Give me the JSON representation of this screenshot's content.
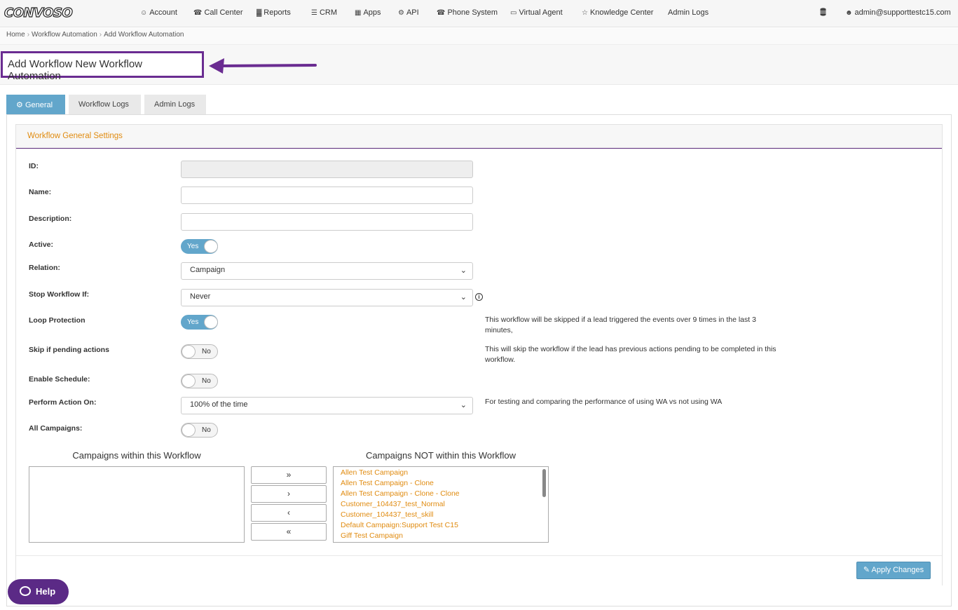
{
  "navbar": {
    "logo": "CONVOSO",
    "items": [
      {
        "label": "Account",
        "icon": "user-icon",
        "glyph": "☺"
      },
      {
        "label": "Call Center",
        "icon": "phone-icon",
        "glyph": "☎"
      },
      {
        "label": "Reports",
        "icon": "bar-chart-icon",
        "glyph": "▓"
      },
      {
        "label": "CRM",
        "icon": "list-icon",
        "glyph": "☰"
      },
      {
        "label": "Apps",
        "icon": "grid-icon",
        "glyph": "▦"
      },
      {
        "label": "API",
        "icon": "gear-icon",
        "glyph": "⚙"
      },
      {
        "label": "Phone System",
        "icon": "phone-icon",
        "glyph": "☎"
      },
      {
        "label": "Virtual Agent",
        "icon": "monitor-icon",
        "glyph": "▭"
      },
      {
        "label": "Knowledge Center",
        "icon": "lightbulb-icon",
        "glyph": "☆"
      },
      {
        "label": "Admin Logs",
        "icon": "",
        "glyph": ""
      }
    ],
    "database_icon": "database-icon",
    "user_email": "admin@supporttestc15.com"
  },
  "breadcrumb": [
    "Home",
    "Workflow Automation",
    "Add Workflow Automation"
  ],
  "page_title": "Add Workflow New Workflow Automation",
  "tabs": [
    {
      "label": "General",
      "active": true
    },
    {
      "label": "Workflow Logs",
      "active": false
    },
    {
      "label": "Admin Logs",
      "active": false
    }
  ],
  "card_title": "Workflow General Settings",
  "form": {
    "id_label": "ID:",
    "id_value": "",
    "name_label": "Name:",
    "name_value": "",
    "description_label": "Description:",
    "description_value": "",
    "active_label": "Active:",
    "active_value": "Yes",
    "relation_label": "Relation:",
    "relation_value": "Campaign",
    "stop_label": "Stop Workflow If:",
    "stop_value": "Never",
    "loop_label": "Loop Protection",
    "loop_value": "Yes",
    "loop_note": "This workflow will be skipped if a lead triggered the events over 9 times in the last 3 minutes,",
    "skip_label": "Skip if pending actions",
    "skip_value": "No",
    "skip_note": "This will skip the workflow if the lead has previous actions pending to be completed in this workflow.",
    "schedule_label": "Enable Schedule:",
    "schedule_value": "No",
    "perform_label": "Perform Action On:",
    "perform_value": "100% of the time",
    "perform_note": "For testing and comparing the performance of using WA vs not using WA",
    "all_campaigns_label": "All Campaigns:",
    "all_campaigns_value": "No"
  },
  "campaigns": {
    "within_title": "Campaigns within this Workflow",
    "not_within_title": "Campaigns NOT within this Workflow",
    "within": [],
    "not_within": [
      "Allen Test Campaign",
      "Allen Test Campaign - Clone",
      "Allen Test Campaign - Clone - Clone",
      "Customer_104437_test_Normal",
      "Customer_104437_test_skill",
      "Default Campaign:Support Test C15",
      "Giff Test Campaign"
    ],
    "buttons": [
      "»",
      "›",
      "‹",
      "«"
    ]
  },
  "apply_label": "Apply Changes",
  "help_label": "Help",
  "accent_colors": {
    "purple": "#6a2c91",
    "blue": "#62a6cb",
    "orange": "#e08b10"
  }
}
